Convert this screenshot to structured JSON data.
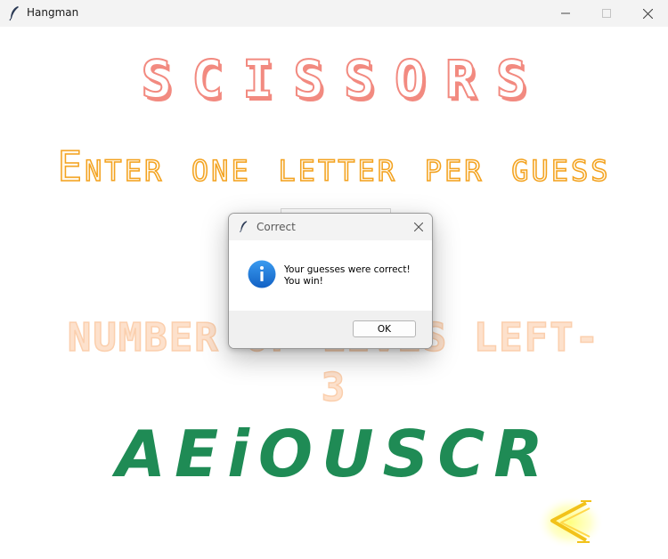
{
  "window": {
    "title": "Hangman"
  },
  "game": {
    "word": "SCISSORS",
    "instruction": "Enter one letter per guess",
    "guess_value": "",
    "lives_text": "NUMBER OF LIVES LEFT-\n3",
    "guessed_letters": "AEiOUSCR",
    "back_icon": "back-arrow-icon"
  },
  "dialog": {
    "title": "Correct",
    "message": "Your guesses were correct!\nYou win!",
    "icon": "info-icon",
    "ok_label": "OK"
  },
  "colors": {
    "word_outline": "#f28a80",
    "instruction_outline": "#f3a21f",
    "lives_fill": "#fde1cc",
    "guessed_letters": "#1f8b55",
    "info_icon_blue": "#1a78d4",
    "arrow_glow": "#ffff60"
  }
}
